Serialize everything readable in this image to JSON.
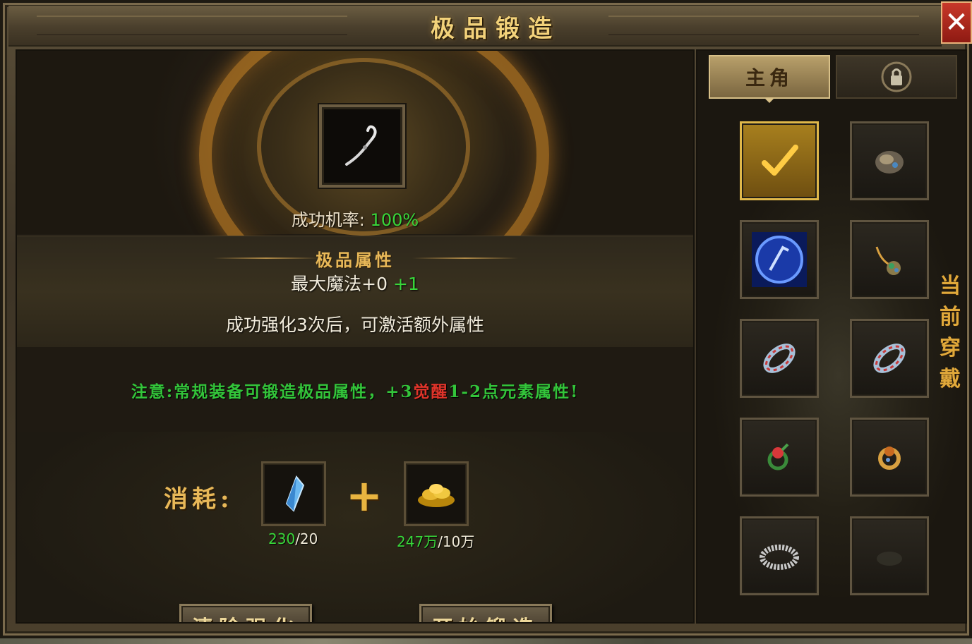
{
  "window": {
    "title": "极品锻造",
    "close_label": "✕"
  },
  "forge": {
    "success_rate_label": "成功机率:",
    "success_rate_value": "100%",
    "attr_title": "极品属性",
    "attr_stat": "最大魔法+0",
    "attr_bonus": "+1",
    "attr_hint": "成功强化3次后，可激活额外属性",
    "notice_prefix": "注意:常规装备可锻造极品属性，",
    "notice_plus": "+3",
    "notice_awaken": "觉醒",
    "notice_range": "1-2",
    "notice_suffix": "点元素属性!",
    "cost_label": "消耗:",
    "cost_plus": "+",
    "crystal_have": "230",
    "crystal_need": "/20",
    "gold_have": "247万",
    "gold_need": "/10万",
    "clear_button": "清除强化",
    "start_button": "开始锻造"
  },
  "sidebar": {
    "tab_main": "主角",
    "tab_other_icon": "lock-icon",
    "side_label": "当前穿戴",
    "slots": [
      "checked-slot",
      "helmet-icon",
      "blue-orb-icon",
      "necklace-icon",
      "bracelet-icon",
      "bracelet-icon",
      "ring-icon",
      "ring-icon",
      "belt-icon",
      "empty-slot"
    ]
  },
  "colors": {
    "accent_gold": "#e8b858",
    "success_green": "#39d63a",
    "warning_red": "#e0342a",
    "close_red": "#c8382a"
  }
}
